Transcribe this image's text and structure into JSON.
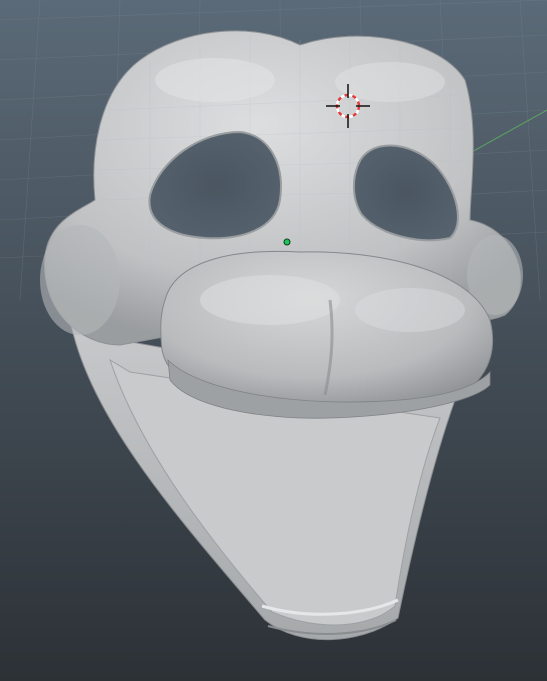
{
  "viewport": {
    "background_top": "#5b6a78",
    "background_bottom": "#2c3136",
    "grid_color": "#7d8a96"
  },
  "model": {
    "body_color": "#c9cbcd",
    "shadow_color": "#8f9295",
    "highlight_color": "#e8e9ea",
    "wireframe_color": "#b6bfc8"
  },
  "gizmos": {
    "cursor_3d": {
      "ring_color": "#e23b3b",
      "cross_color": "#111111"
    },
    "origin_point": {
      "color": "#21c25b"
    },
    "axis_line": {
      "color": "#5fb65f"
    }
  }
}
